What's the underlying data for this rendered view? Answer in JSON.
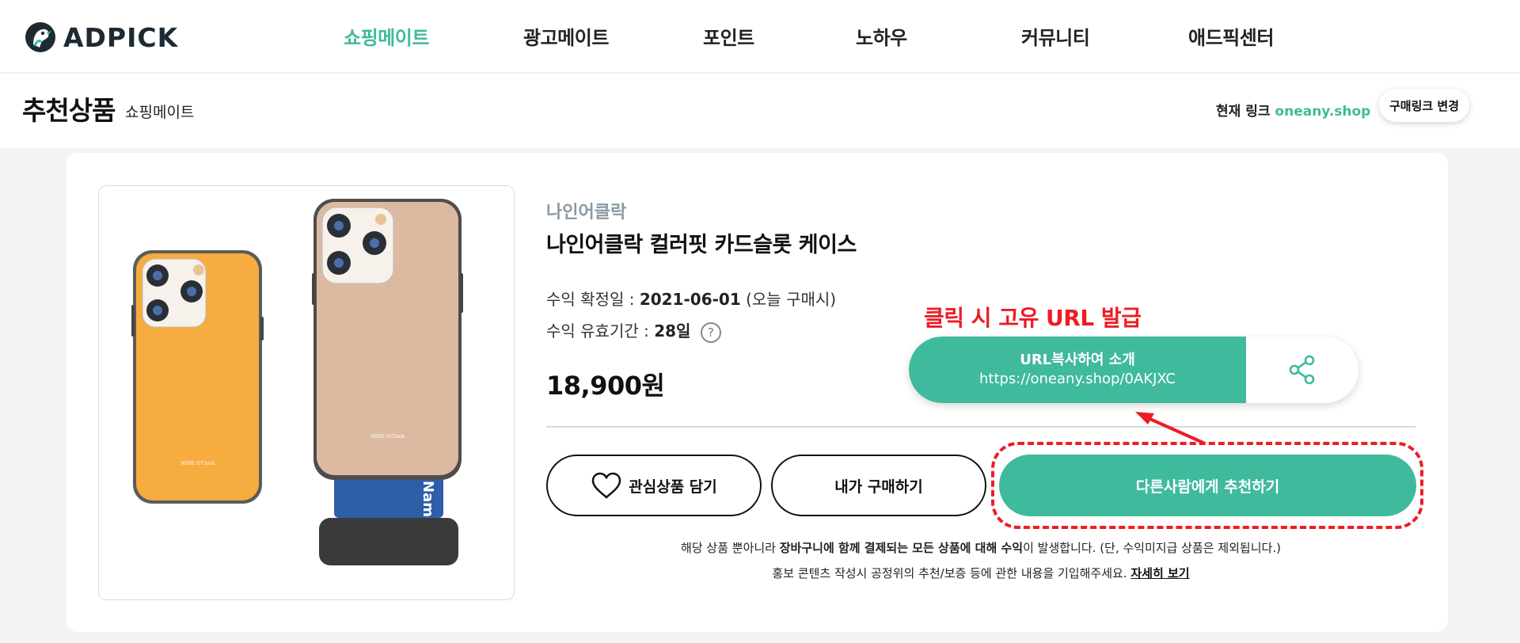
{
  "header": {
    "logo_text": "ADPICK",
    "nav": [
      {
        "label": "쇼핑메이트",
        "active": true
      },
      {
        "label": "광고메이트",
        "active": false
      },
      {
        "label": "포인트",
        "active": false
      },
      {
        "label": "노하우",
        "active": false
      },
      {
        "label": "커뮤니티",
        "active": false
      },
      {
        "label": "애드픽센터",
        "active": false
      }
    ]
  },
  "subheader": {
    "title": "추천상품",
    "subtitle": "쇼핑메이트",
    "current_link_label": "현재 링크",
    "current_link_domain": "oneany.shop",
    "change_link_button": "구매링크 변경"
  },
  "product": {
    "brand": "나인어클락",
    "name": "나인어클락 컬러핏 카드슬롯 케이스",
    "confirm_date_label": "수익 확정일 :",
    "confirm_date_value": "2021-06-01",
    "confirm_date_note": "(오늘 구매시)",
    "valid_period_label": "수익 유효기간 :",
    "valid_period_value": "28일",
    "help_icon_text": "?",
    "price": "18,900원",
    "image_brand_text": "NINE O'Clock",
    "image_card_text": "Name"
  },
  "annotation": {
    "text": "클릭 시 고유 URL 발급"
  },
  "url_share": {
    "label": "URL복사하여 소개",
    "url": "https://oneany.shop/0AKJXC"
  },
  "actions": {
    "wishlist": "관심상품 담기",
    "buy_myself": "내가 구매하기",
    "recommend": "다른사람에게 추천하기"
  },
  "notes": {
    "line1_pre": "해당 상품 뿐아니라 ",
    "line1_bold": "장바구니에 함께 결제되는 모든 상품에 대해 수익",
    "line1_post": "이 발생합니다. (단, 수익미지급 상품은 제외됩니다.)",
    "line2": "홍보 콘텐츠 작성시 공정위의 추천/보증 등에 관한 내용을 기입해주세요.",
    "line2_link": "자세히 보기"
  },
  "colors": {
    "accent": "#3fba9c",
    "annotation_red": "#ee1c25",
    "brand_gray": "#8a9aa3",
    "case_orange": "#f7ac3f",
    "case_beige": "#dcbaa1"
  }
}
